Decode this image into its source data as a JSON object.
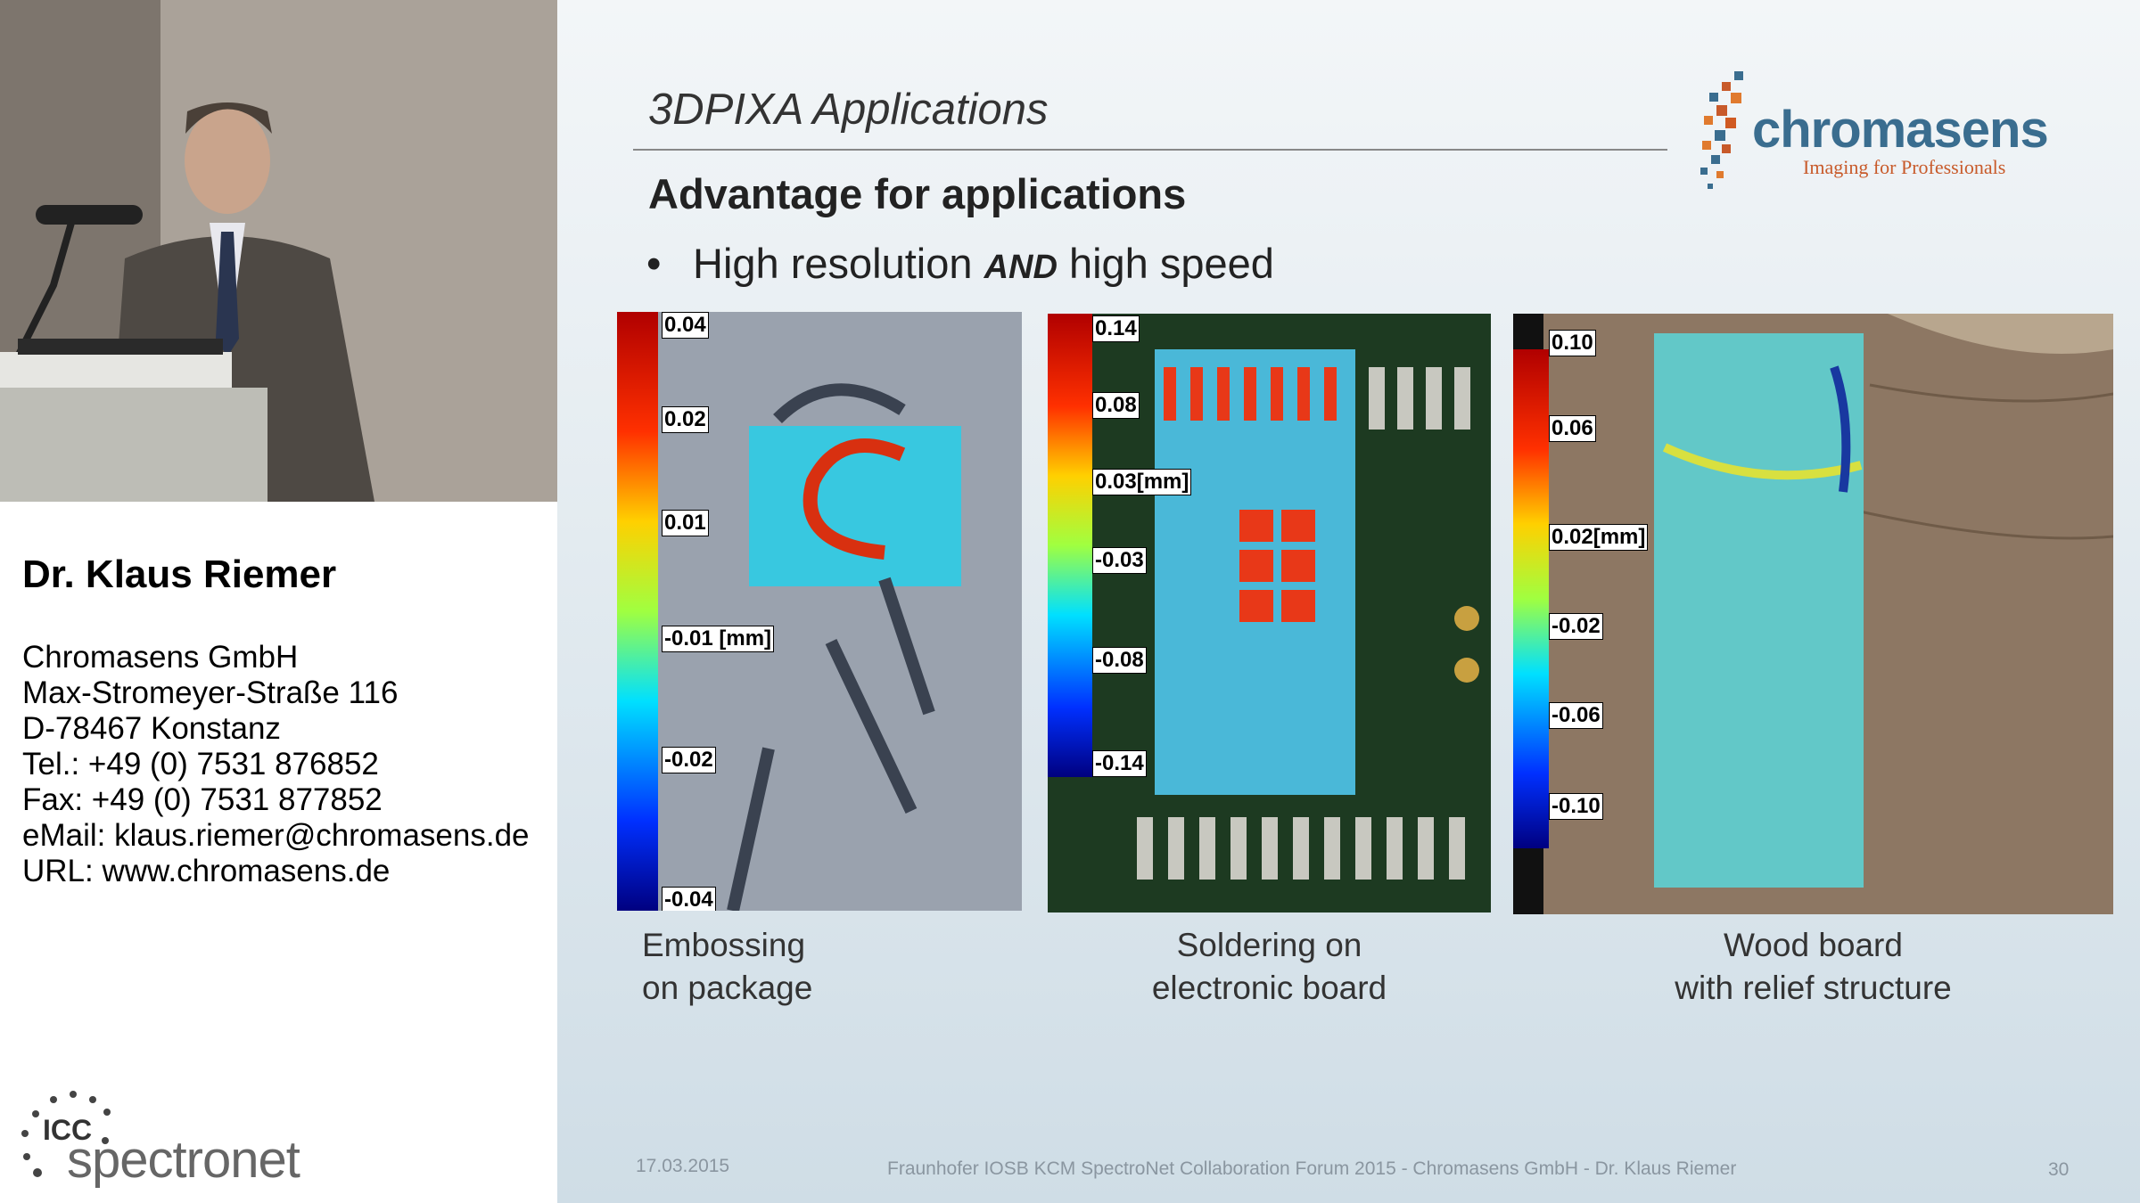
{
  "speaker": {
    "name": "Dr. Klaus Riemer",
    "lines": [
      "Chromasens GmbH",
      "Max-Stromeyer-Straße 116",
      "D-78467 Konstanz",
      "Tel.: +49 (0) 7531 876852",
      "Fax: +49 (0) 7531 877852",
      "eMail: klaus.riemer@chromasens.de",
      "URL: www.chromasens.de"
    ]
  },
  "event_logo": {
    "top": "ICC",
    "bottom": "spectronet"
  },
  "slide": {
    "title": "3DPIXA  Applications",
    "subtitle": "Advantage for applications",
    "bullet": {
      "before": "High resolution ",
      "emphasis": "AND",
      "after": " high speed"
    },
    "logo": {
      "name": "chromasens",
      "tagline": "Imaging for Professionals"
    },
    "panels": [
      {
        "ticks": [
          "0.04",
          "0.02",
          "0.01",
          "-0.01 [mm]",
          "-0.02",
          "-0.04"
        ],
        "caption": [
          "Embossing",
          "on package"
        ]
      },
      {
        "ticks": [
          "0.14",
          "0.08",
          "0.03[mm]",
          "-0.03",
          "-0.08",
          "-0.14"
        ],
        "caption": [
          "Soldering on",
          "electronic board"
        ]
      },
      {
        "ticks": [
          "0.10",
          "0.06",
          "0.02[mm]",
          "-0.02",
          "-0.06",
          "-0.10"
        ],
        "caption": [
          "Wood board",
          "with relief structure"
        ]
      }
    ],
    "footer": {
      "date": "17.03.2015",
      "text": "Fraunhofer IOSB KCM SpectroNet Collaboration Forum 2015 - Chromasens GmbH - Dr. Klaus Riemer",
      "page": "30"
    }
  },
  "colors": {
    "logo_blue": "#3a6d8f",
    "logo_orange": "#c85a2a"
  }
}
